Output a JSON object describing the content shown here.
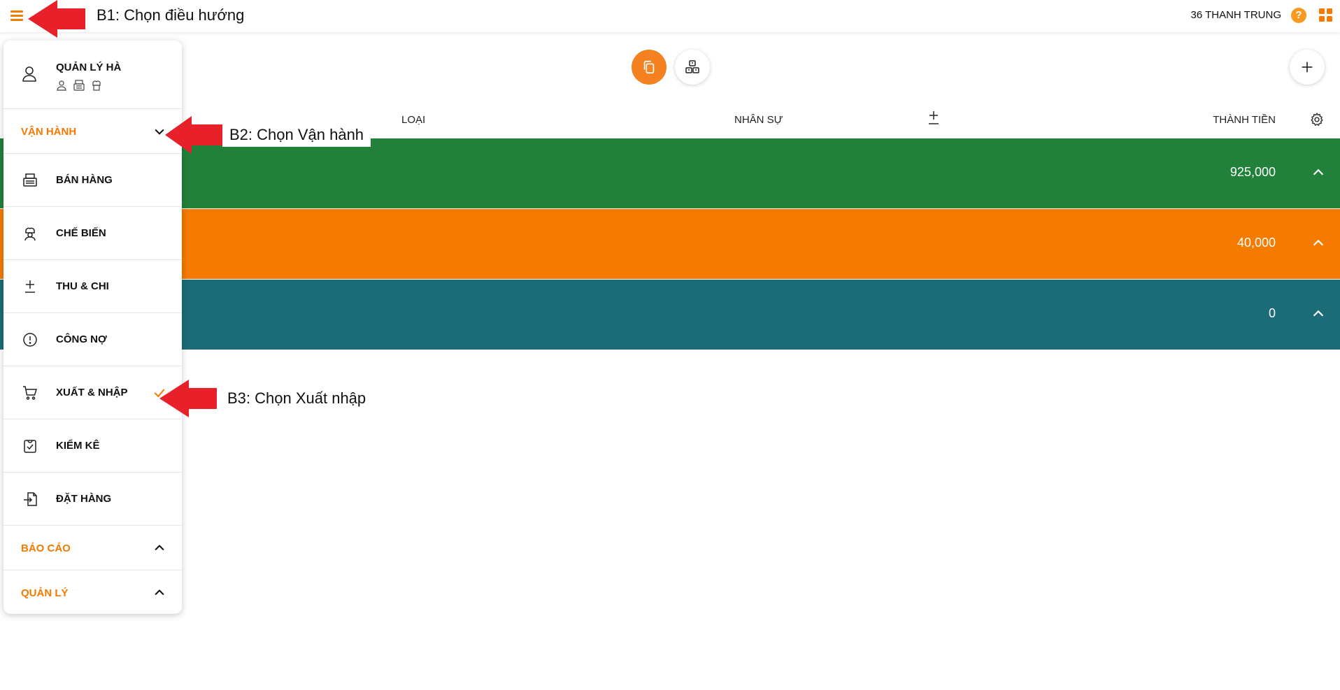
{
  "topbar": {
    "title": "B1: Chọn điều hướng",
    "store_name": "36 THANH TRUNG",
    "help_symbol": "?"
  },
  "table": {
    "headers": {
      "type": "LOẠI",
      "staff": "NHÂN SỰ",
      "total": "THÀNH TIỀN"
    },
    "rows": [
      {
        "value": "925,000",
        "color": "#21813a"
      },
      {
        "value": "40,000",
        "color": "#f57a00"
      },
      {
        "value": "0",
        "color": "#1b6c77"
      }
    ]
  },
  "sidebar": {
    "user_name": "QUẢN LÝ HÀ",
    "sections": {
      "operations": "VẬN HÀNH",
      "reports": "BÁO CÁO",
      "management": "QUẢN LÝ"
    },
    "items": [
      {
        "label": "BÁN HÀNG",
        "icon": "cash-register-icon"
      },
      {
        "label": "CHẾ BIẾN",
        "icon": "chef-icon"
      },
      {
        "label": "THU & CHI",
        "icon": "plus-minus-icon"
      },
      {
        "label": "CÔNG NỢ",
        "icon": "exclamation-circle-icon"
      },
      {
        "label": "XUẤT & NHẬP",
        "icon": "cart-icon",
        "selected": true
      },
      {
        "label": "KIỂM KÊ",
        "icon": "inventory-check-icon"
      },
      {
        "label": "ĐẶT HÀNG",
        "icon": "order-import-icon"
      }
    ]
  },
  "annotations": {
    "step2": "B2: Chọn Vận hành",
    "step3": "B3: Chọn Xuất nhập"
  },
  "colors": {
    "accent": "#f47a00",
    "annotation_arrow": "#e8202a"
  }
}
